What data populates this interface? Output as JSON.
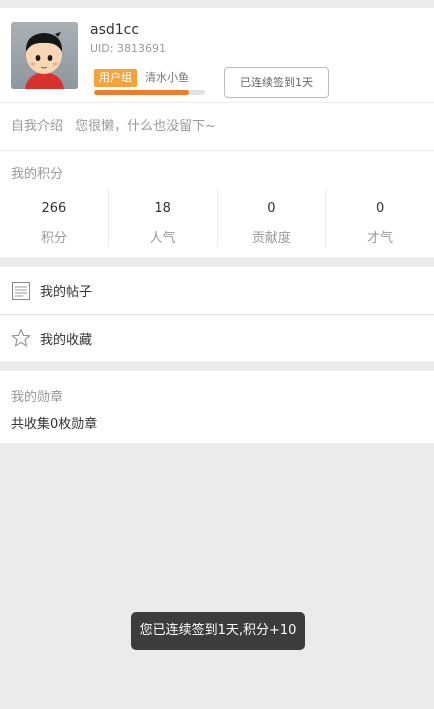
{
  "profile": {
    "username": "asd1cc",
    "uid": "UID: 3813691",
    "group_tag": "用户组",
    "group_name": "清水小鱼",
    "level_progress": 0.86,
    "checkin_label": "已连续签到1天"
  },
  "intro": {
    "label": "自我介绍",
    "text": "您很懒，什么也没留下~"
  },
  "scores": {
    "title": "我的积分",
    "items": [
      {
        "value": "266",
        "label": "积分"
      },
      {
        "value": "18",
        "label": "人气"
      },
      {
        "value": "0",
        "label": "贡献度"
      },
      {
        "value": "0",
        "label": "才气"
      }
    ]
  },
  "menu": {
    "posts_label": "我的帖子",
    "favorites_label": "我的收藏"
  },
  "medals": {
    "title": "我的勋章",
    "count_text": "共收集0枚勋章"
  },
  "toast": {
    "text": "您已连续签到1天,积分+10"
  },
  "colors": {
    "accent_orange": "#f2a33a",
    "progress_fill": "#f07d2e",
    "background": "#ebebeb"
  },
  "icons": {
    "posts": "document-icon",
    "favorites": "star-outline-icon"
  }
}
